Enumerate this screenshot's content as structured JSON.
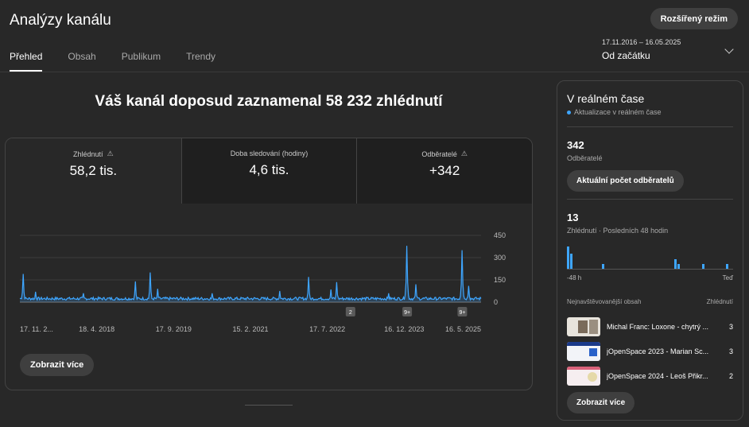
{
  "header": {
    "title": "Analýzy kanálu",
    "advanced_mode": "Rozšířený režim"
  },
  "tabs": [
    {
      "label": "Přehled",
      "active": true
    },
    {
      "label": "Obsah",
      "active": false
    },
    {
      "label": "Publikum",
      "active": false
    },
    {
      "label": "Trendy",
      "active": false
    }
  ],
  "date": {
    "range": "17.11.2016 – 16.05.2025",
    "label": "Od začátku"
  },
  "headline": "Váš kanál doposud zaznamenal 58 232 zhlédnutí",
  "metrics": [
    {
      "label": "Zhlédnutí",
      "value": "58,2 tis.",
      "warning": "⚠"
    },
    {
      "label": "Doba sledování (hodiny)",
      "value": "4,6 tis."
    },
    {
      "label": "Odběratelé",
      "value": "+342",
      "warning": "⚠"
    }
  ],
  "chart_data": {
    "type": "line",
    "y_ticks": [
      "450",
      "300",
      "150",
      "0"
    ],
    "ylim": [
      0,
      450
    ],
    "x_ticks": [
      "17. 11. 2...",
      "18. 4. 2018",
      "17. 9. 2019",
      "15. 2. 2021",
      "17. 7. 2022",
      "16. 12. 2023",
      "16. 5. 2025"
    ],
    "x_range": [
      "2016-11-17",
      "2025-05-16"
    ],
    "peaks": [
      {
        "date": "2016-12-10",
        "value": 190
      },
      {
        "date": "2017-03-01",
        "value": 70
      },
      {
        "date": "2018-01-20",
        "value": 60
      },
      {
        "date": "2019-01-05",
        "value": 140
      },
      {
        "date": "2019-04-10",
        "value": 200
      },
      {
        "date": "2019-06-01",
        "value": 90
      },
      {
        "date": "2020-06-01",
        "value": 60
      },
      {
        "date": "2021-09-01",
        "value": 75
      },
      {
        "date": "2022-03-15",
        "value": 170
      },
      {
        "date": "2022-08-10",
        "value": 85
      },
      {
        "date": "2022-09-20",
        "value": 135
      },
      {
        "date": "2023-09-01",
        "value": 60
      },
      {
        "date": "2024-01-05",
        "value": 380
      },
      {
        "date": "2024-03-01",
        "value": 120
      },
      {
        "date": "2025-01-10",
        "value": 350
      },
      {
        "date": "2025-02-20",
        "value": 110
      }
    ],
    "baseline": 25,
    "markers": [
      {
        "date": "2022-12-20",
        "label": "2"
      },
      {
        "date": "2024-01-05",
        "label": "9+"
      },
      {
        "date": "2025-01-10",
        "label": "9+"
      }
    ],
    "color": "#3ea6ff"
  },
  "more_label": "Zobrazit více",
  "realtime": {
    "title": "V reálném čase",
    "subtitle": "Aktualizace v reálném čase",
    "subscribers_count": "342",
    "subscribers_label": "Odběratelé",
    "subscribers_button": "Aktuální počet odběratelů",
    "views_count": "13",
    "views_label": "Zhlédnutí · Posledních 48 hodin",
    "views_bars": [
      9,
      6,
      0,
      0,
      0,
      0,
      0,
      0,
      0,
      0,
      2,
      0,
      0,
      0,
      0,
      0,
      0,
      0,
      0,
      0,
      0,
      0,
      0,
      0,
      0,
      0,
      0,
      0,
      0,
      0,
      0,
      4,
      2,
      0,
      0,
      0,
      0,
      0,
      0,
      2,
      0,
      0,
      0,
      0,
      0,
      0,
      2,
      0
    ],
    "axis_start": "-48 h",
    "axis_end": "Teď",
    "top_header_left": "Nejnavštěvovanější obsah",
    "top_header_right": "Zhlédnutí",
    "top_items": [
      {
        "title": "Michal Franc: Loxone - chytrý ...",
        "views": "3"
      },
      {
        "title": "jOpenSpace 2023 - Marian Sc...",
        "views": "3"
      },
      {
        "title": "jOpenSpace 2024 - Leoš Přikr...",
        "views": "2"
      }
    ],
    "more_label": "Zobrazit více"
  }
}
